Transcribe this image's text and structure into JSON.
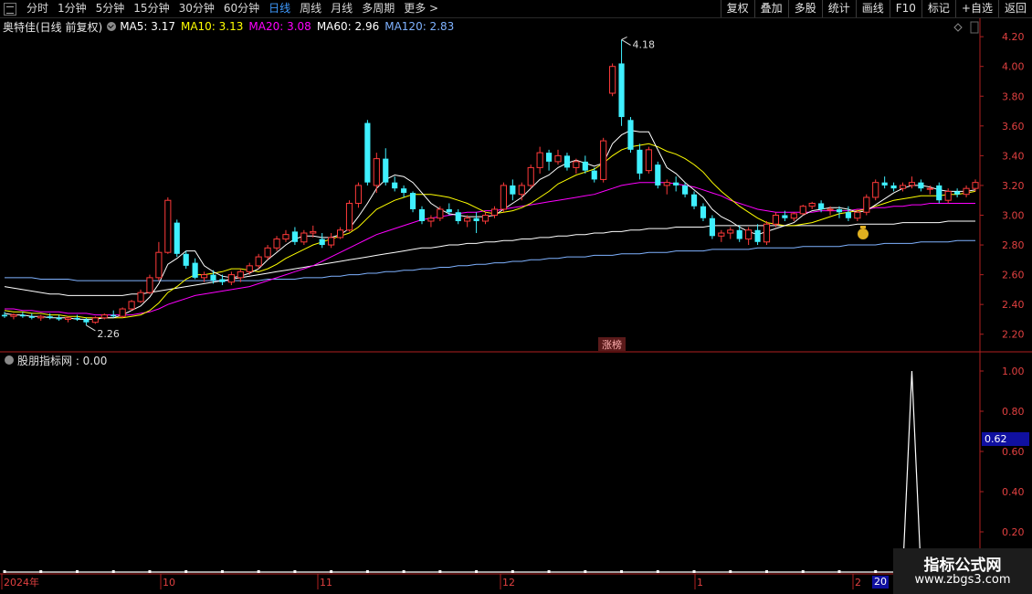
{
  "toolbar": {
    "periods": [
      "分时",
      "1分钟",
      "5分钟",
      "15分钟",
      "30分钟",
      "60分钟",
      "日线",
      "周线",
      "月线",
      "多周期",
      "更多 >"
    ],
    "active_period": "日线",
    "right_buttons": [
      "复权",
      "叠加",
      "多股",
      "统计",
      "画线",
      "F10",
      "标记",
      "+自选",
      "返回"
    ]
  },
  "legend": {
    "stock": "奥特佳(日线 前复权)",
    "ma": [
      {
        "label": "MA5: 3.17",
        "color": "#ffffff"
      },
      {
        "label": "MA10: 3.13",
        "color": "#ffff00"
      },
      {
        "label": "MA20: 3.08",
        "color": "#ff00ff"
      },
      {
        "label": "MA60: 2.96",
        "color": "#ffffff"
      },
      {
        "label": "MA120: 2.83",
        "color": "#7fb2ff"
      }
    ]
  },
  "indicator": {
    "label": "股朋指标网 : 0.00",
    "y_ticks": [
      "1.00",
      "0.80",
      "0.60",
      "0.40",
      "0.20"
    ],
    "cursor_value": "0.62"
  },
  "price_axis": {
    "ticks": [
      "4.20",
      "4.00",
      "3.80",
      "3.60",
      "3.40",
      "3.20",
      "3.00",
      "2.80",
      "2.60",
      "2.40",
      "2.20"
    ]
  },
  "annotations": {
    "high": "4.18",
    "low": "2.26",
    "zhangbang": "涨榜"
  },
  "x_axis": {
    "labels": [
      "2024年",
      "10",
      "11",
      "12",
      "1",
      "2"
    ],
    "cursor_date": "20"
  },
  "watermark": {
    "title": "指标公式网",
    "url": "www.zbgs3.com"
  },
  "colors": {
    "up": "#ff3a3a",
    "down": "#3ff0ff",
    "ma5": "#ffffff",
    "ma10": "#ffff00",
    "ma20": "#ff00ff",
    "ma60": "#ffffff",
    "ma120": "#7fb2ff",
    "axis": "#b02020"
  },
  "chart_data": {
    "type": "candlestick",
    "y_range": [
      2.1,
      4.25
    ],
    "candles": [
      [
        2.33,
        2.35,
        2.31,
        2.32
      ],
      [
        2.32,
        2.34,
        2.3,
        2.33
      ],
      [
        2.33,
        2.35,
        2.31,
        2.32
      ],
      [
        2.32,
        2.34,
        2.3,
        2.31
      ],
      [
        2.31,
        2.33,
        2.29,
        2.32
      ],
      [
        2.32,
        2.34,
        2.3,
        2.31
      ],
      [
        2.31,
        2.33,
        2.29,
        2.3
      ],
      [
        2.3,
        2.32,
        2.28,
        2.31
      ],
      [
        2.31,
        2.33,
        2.29,
        2.3
      ],
      [
        2.3,
        2.31,
        2.26,
        2.28
      ],
      [
        2.28,
        2.32,
        2.27,
        2.31
      ],
      [
        2.31,
        2.34,
        2.3,
        2.33
      ],
      [
        2.33,
        2.36,
        2.31,
        2.32
      ],
      [
        2.32,
        2.38,
        2.31,
        2.37
      ],
      [
        2.37,
        2.43,
        2.36,
        2.42
      ],
      [
        2.42,
        2.5,
        2.41,
        2.48
      ],
      [
        2.48,
        2.6,
        2.47,
        2.58
      ],
      [
        2.58,
        2.82,
        2.56,
        2.75
      ],
      [
        2.75,
        3.12,
        2.74,
        3.1
      ],
      [
        2.95,
        2.97,
        2.72,
        2.74
      ],
      [
        2.74,
        2.76,
        2.64,
        2.66
      ],
      [
        2.68,
        2.71,
        2.57,
        2.58
      ],
      [
        2.58,
        2.62,
        2.55,
        2.6
      ],
      [
        2.6,
        2.63,
        2.54,
        2.56
      ],
      [
        2.57,
        2.6,
        2.53,
        2.55
      ],
      [
        2.55,
        2.62,
        2.53,
        2.6
      ],
      [
        2.58,
        2.64,
        2.55,
        2.62
      ],
      [
        2.62,
        2.68,
        2.6,
        2.66
      ],
      [
        2.66,
        2.74,
        2.64,
        2.72
      ],
      [
        2.72,
        2.8,
        2.7,
        2.78
      ],
      [
        2.78,
        2.86,
        2.76,
        2.84
      ],
      [
        2.84,
        2.9,
        2.82,
        2.87
      ],
      [
        2.89,
        2.92,
        2.8,
        2.82
      ],
      [
        2.82,
        2.9,
        2.8,
        2.88
      ],
      [
        2.88,
        2.93,
        2.85,
        2.89
      ],
      [
        2.84,
        2.88,
        2.78,
        2.8
      ],
      [
        2.8,
        2.88,
        2.78,
        2.85
      ],
      [
        2.85,
        2.92,
        2.84,
        2.9
      ],
      [
        2.9,
        3.1,
        2.89,
        3.08
      ],
      [
        3.08,
        3.22,
        3.05,
        3.2
      ],
      [
        3.62,
        3.64,
        3.2,
        3.22
      ],
      [
        3.2,
        3.42,
        3.15,
        3.38
      ],
      [
        3.38,
        3.45,
        3.2,
        3.22
      ],
      [
        3.22,
        3.26,
        3.16,
        3.18
      ],
      [
        3.18,
        3.2,
        3.12,
        3.15
      ],
      [
        3.15,
        3.16,
        3.02,
        3.04
      ],
      [
        3.04,
        3.06,
        2.94,
        2.96
      ],
      [
        2.96,
        3.0,
        2.92,
        2.98
      ],
      [
        2.98,
        3.06,
        2.96,
        3.04
      ],
      [
        3.04,
        3.08,
        3.0,
        3.02
      ],
      [
        3.02,
        3.04,
        2.94,
        2.96
      ],
      [
        2.96,
        3.0,
        2.92,
        2.98
      ],
      [
        2.98,
        3.02,
        2.88,
        2.96
      ],
      [
        2.96,
        3.02,
        2.94,
        3.0
      ],
      [
        3.0,
        3.06,
        2.98,
        3.04
      ],
      [
        3.04,
        3.22,
        3.02,
        3.2
      ],
      [
        3.2,
        3.24,
        3.1,
        3.14
      ],
      [
        3.14,
        3.22,
        3.1,
        3.2
      ],
      [
        3.2,
        3.34,
        3.18,
        3.32
      ],
      [
        3.32,
        3.46,
        3.28,
        3.42
      ],
      [
        3.42,
        3.44,
        3.3,
        3.36
      ],
      [
        3.36,
        3.44,
        3.34,
        3.4
      ],
      [
        3.4,
        3.42,
        3.3,
        3.32
      ],
      [
        3.32,
        3.38,
        3.28,
        3.36
      ],
      [
        3.36,
        3.4,
        3.28,
        3.3
      ],
      [
        3.3,
        3.32,
        3.22,
        3.24
      ],
      [
        3.24,
        3.52,
        3.22,
        3.5
      ],
      [
        3.82,
        4.02,
        3.8,
        4.0
      ],
      [
        4.02,
        4.18,
        3.6,
        3.66
      ],
      [
        3.64,
        3.66,
        3.42,
        3.44
      ],
      [
        3.44,
        3.48,
        3.24,
        3.28
      ],
      [
        3.3,
        3.46,
        3.28,
        3.44
      ],
      [
        3.34,
        3.36,
        3.18,
        3.2
      ],
      [
        3.2,
        3.24,
        3.14,
        3.22
      ],
      [
        3.22,
        3.26,
        3.16,
        3.2
      ],
      [
        3.2,
        3.22,
        3.12,
        3.14
      ],
      [
        3.14,
        3.16,
        3.04,
        3.06
      ],
      [
        3.06,
        3.08,
        2.96,
        2.98
      ],
      [
        2.98,
        3.0,
        2.84,
        2.86
      ],
      [
        2.86,
        2.9,
        2.82,
        2.88
      ],
      [
        2.88,
        2.92,
        2.84,
        2.9
      ],
      [
        2.9,
        2.93,
        2.82,
        2.84
      ],
      [
        2.84,
        2.92,
        2.8,
        2.9
      ],
      [
        2.9,
        2.94,
        2.8,
        2.82
      ],
      [
        2.82,
        2.96,
        2.8,
        2.94
      ],
      [
        2.94,
        3.02,
        2.92,
        3.0
      ],
      [
        3.0,
        3.03,
        2.96,
        2.98
      ],
      [
        2.98,
        3.02,
        2.96,
        3.01
      ],
      [
        3.01,
        3.07,
        3.0,
        3.06
      ],
      [
        3.06,
        3.09,
        3.04,
        3.08
      ],
      [
        3.08,
        3.1,
        3.02,
        3.04
      ],
      [
        3.04,
        3.06,
        3.0,
        3.04
      ],
      [
        3.04,
        3.06,
        2.98,
        3.02
      ],
      [
        3.02,
        3.06,
        2.96,
        2.98
      ],
      [
        2.98,
        3.04,
        2.96,
        3.02
      ],
      [
        3.02,
        3.14,
        3.0,
        3.12
      ],
      [
        3.12,
        3.24,
        3.1,
        3.22
      ],
      [
        3.22,
        3.26,
        3.18,
        3.2
      ],
      [
        3.2,
        3.22,
        3.16,
        3.18
      ],
      [
        3.18,
        3.22,
        3.16,
        3.2
      ],
      [
        3.2,
        3.26,
        3.18,
        3.22
      ],
      [
        3.22,
        3.24,
        3.16,
        3.18
      ],
      [
        3.18,
        3.2,
        3.14,
        3.18
      ],
      [
        3.2,
        3.22,
        3.08,
        3.1
      ],
      [
        3.1,
        3.18,
        3.08,
        3.16
      ],
      [
        3.16,
        3.18,
        3.12,
        3.14
      ],
      [
        3.14,
        3.2,
        3.12,
        3.18
      ],
      [
        3.18,
        3.24,
        3.16,
        3.22
      ]
    ],
    "ma5": [
      2.34,
      2.33,
      2.33,
      2.32,
      2.32,
      2.31,
      2.31,
      2.31,
      2.3,
      2.3,
      2.3,
      2.31,
      2.31,
      2.33,
      2.36,
      2.39,
      2.45,
      2.54,
      2.67,
      2.71,
      2.76,
      2.76,
      2.66,
      2.62,
      2.59,
      2.58,
      2.59,
      2.61,
      2.64,
      2.7,
      2.75,
      2.8,
      2.84,
      2.86,
      2.86,
      2.85,
      2.85,
      2.87,
      2.91,
      2.99,
      3.08,
      3.18,
      3.24,
      3.27,
      3.26,
      3.22,
      3.15,
      3.08,
      3.04,
      3.01,
      3.0,
      2.99,
      2.99,
      2.99,
      3.0,
      3.04,
      3.08,
      3.12,
      3.18,
      3.24,
      3.27,
      3.32,
      3.35,
      3.37,
      3.35,
      3.33,
      3.35,
      3.48,
      3.54,
      3.57,
      3.56,
      3.56,
      3.44,
      3.32,
      3.28,
      3.22,
      3.17,
      3.12,
      3.04,
      2.99,
      2.96,
      2.92,
      2.89,
      2.87,
      2.89,
      2.91,
      2.93,
      2.95,
      3.0,
      3.03,
      3.04,
      3.05,
      3.05,
      3.04,
      3.02,
      3.03,
      3.07,
      3.11,
      3.15,
      3.18,
      3.2,
      3.2,
      3.19,
      3.17,
      3.16,
      3.16,
      3.16,
      3.17
    ],
    "ma10": [
      2.36,
      2.35,
      2.35,
      2.34,
      2.34,
      2.33,
      2.33,
      2.32,
      2.32,
      2.31,
      2.31,
      2.31,
      2.31,
      2.31,
      2.32,
      2.33,
      2.36,
      2.41,
      2.48,
      2.52,
      2.57,
      2.6,
      2.6,
      2.61,
      2.62,
      2.64,
      2.64,
      2.63,
      2.62,
      2.64,
      2.67,
      2.71,
      2.74,
      2.77,
      2.8,
      2.82,
      2.84,
      2.86,
      2.88,
      2.92,
      2.98,
      3.04,
      3.07,
      3.1,
      3.12,
      3.14,
      3.14,
      3.14,
      3.13,
      3.12,
      3.1,
      3.08,
      3.05,
      3.02,
      3.01,
      3.02,
      3.03,
      3.05,
      3.08,
      3.12,
      3.16,
      3.21,
      3.24,
      3.27,
      3.29,
      3.31,
      3.35,
      3.4,
      3.44,
      3.46,
      3.47,
      3.48,
      3.46,
      3.43,
      3.41,
      3.38,
      3.34,
      3.29,
      3.22,
      3.16,
      3.11,
      3.06,
      3.02,
      2.98,
      2.95,
      2.94,
      2.93,
      2.93,
      2.94,
      2.95,
      2.97,
      2.99,
      3.01,
      3.02,
      3.03,
      3.04,
      3.06,
      3.08,
      3.1,
      3.11,
      3.12,
      3.13,
      3.13,
      3.13,
      3.14,
      3.14,
      3.15,
      3.16
    ],
    "ma20": [
      2.37,
      2.37,
      2.36,
      2.36,
      2.35,
      2.35,
      2.35,
      2.34,
      2.34,
      2.34,
      2.33,
      2.33,
      2.33,
      2.33,
      2.33,
      2.34,
      2.35,
      2.37,
      2.4,
      2.42,
      2.44,
      2.46,
      2.47,
      2.48,
      2.49,
      2.5,
      2.51,
      2.52,
      2.54,
      2.56,
      2.58,
      2.6,
      2.62,
      2.64,
      2.66,
      2.69,
      2.72,
      2.75,
      2.78,
      2.81,
      2.84,
      2.87,
      2.89,
      2.91,
      2.93,
      2.95,
      2.97,
      2.98,
      2.99,
      3.0,
      3.01,
      3.02,
      3.02,
      3.03,
      3.03,
      3.04,
      3.05,
      3.06,
      3.07,
      3.08,
      3.09,
      3.1,
      3.11,
      3.12,
      3.13,
      3.14,
      3.16,
      3.18,
      3.2,
      3.21,
      3.22,
      3.22,
      3.22,
      3.22,
      3.21,
      3.2,
      3.19,
      3.17,
      3.15,
      3.13,
      3.1,
      3.08,
      3.06,
      3.04,
      3.03,
      3.02,
      3.02,
      3.02,
      3.02,
      3.02,
      3.03,
      3.03,
      3.03,
      3.03,
      3.04,
      3.04,
      3.05,
      3.05,
      3.06,
      3.06,
      3.07,
      3.07,
      3.08,
      3.08,
      3.08,
      3.08,
      3.08,
      3.08
    ],
    "ma60": [
      2.52,
      2.51,
      2.5,
      2.49,
      2.48,
      2.47,
      2.47,
      2.46,
      2.46,
      2.46,
      2.46,
      2.46,
      2.46,
      2.46,
      2.47,
      2.47,
      2.48,
      2.49,
      2.5,
      2.51,
      2.52,
      2.53,
      2.54,
      2.55,
      2.56,
      2.57,
      2.58,
      2.59,
      2.6,
      2.61,
      2.62,
      2.63,
      2.64,
      2.65,
      2.66,
      2.67,
      2.68,
      2.69,
      2.7,
      2.71,
      2.72,
      2.73,
      2.74,
      2.75,
      2.76,
      2.77,
      2.78,
      2.78,
      2.79,
      2.8,
      2.8,
      2.81,
      2.81,
      2.82,
      2.82,
      2.83,
      2.83,
      2.84,
      2.84,
      2.85,
      2.85,
      2.86,
      2.86,
      2.87,
      2.87,
      2.88,
      2.88,
      2.89,
      2.89,
      2.9,
      2.9,
      2.91,
      2.91,
      2.91,
      2.92,
      2.92,
      2.92,
      2.92,
      2.93,
      2.93,
      2.93,
      2.93,
      2.93,
      2.93,
      2.93,
      2.93,
      2.93,
      2.93,
      2.93,
      2.93,
      2.93,
      2.93,
      2.93,
      2.93,
      2.94,
      2.94,
      2.94,
      2.94,
      2.94,
      2.95,
      2.95,
      2.95,
      2.95,
      2.95,
      2.96,
      2.96,
      2.96,
      2.96
    ],
    "ma120": [
      2.58,
      2.58,
      2.58,
      2.58,
      2.57,
      2.57,
      2.57,
      2.57,
      2.56,
      2.56,
      2.56,
      2.56,
      2.56,
      2.56,
      2.56,
      2.56,
      2.56,
      2.56,
      2.56,
      2.56,
      2.56,
      2.56,
      2.56,
      2.56,
      2.56,
      2.56,
      2.56,
      2.56,
      2.56,
      2.57,
      2.57,
      2.57,
      2.57,
      2.58,
      2.58,
      2.58,
      2.59,
      2.59,
      2.6,
      2.6,
      2.61,
      2.61,
      2.62,
      2.62,
      2.63,
      2.63,
      2.64,
      2.64,
      2.65,
      2.65,
      2.66,
      2.66,
      2.67,
      2.67,
      2.68,
      2.68,
      2.69,
      2.69,
      2.7,
      2.7,
      2.71,
      2.71,
      2.72,
      2.72,
      2.72,
      2.73,
      2.73,
      2.73,
      2.74,
      2.74,
      2.74,
      2.75,
      2.75,
      2.75,
      2.76,
      2.76,
      2.76,
      2.76,
      2.77,
      2.77,
      2.77,
      2.77,
      2.77,
      2.78,
      2.78,
      2.78,
      2.78,
      2.78,
      2.79,
      2.79,
      2.79,
      2.79,
      2.79,
      2.8,
      2.8,
      2.8,
      2.8,
      2.81,
      2.81,
      2.81,
      2.81,
      2.82,
      2.82,
      2.82,
      2.82,
      2.83,
      2.83,
      2.83
    ],
    "indicator": {
      "y_range": [
        0,
        1.05
      ],
      "spike_index": 100,
      "spike_value": 1.0
    }
  }
}
